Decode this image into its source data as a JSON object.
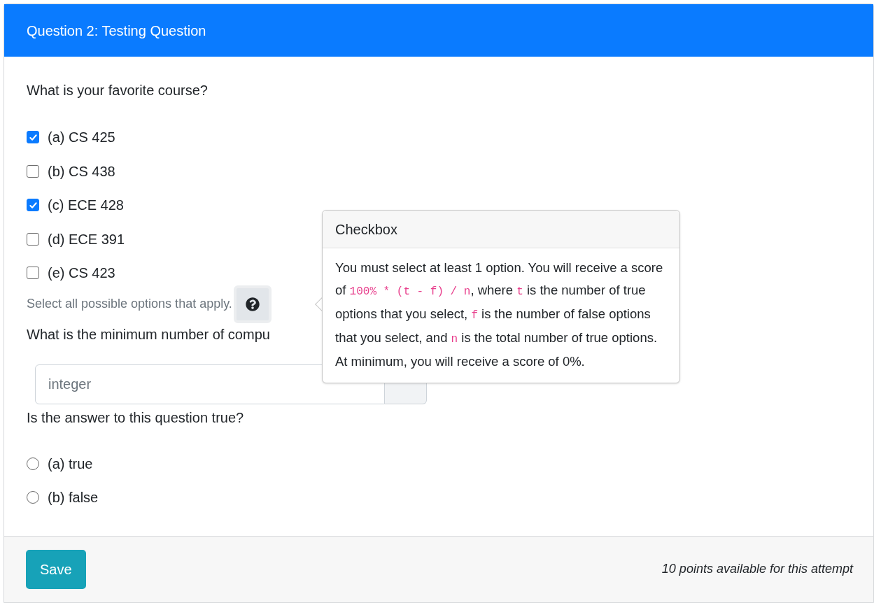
{
  "title": "Question 2: Testing Question",
  "questions": [
    {
      "kind": "checkbox",
      "prompt": "What is your favorite course?",
      "options": [
        {
          "label": "(a) CS 425",
          "checked": true
        },
        {
          "label": "(b) CS 438",
          "checked": false
        },
        {
          "label": "(c) ECE 428",
          "checked": true
        },
        {
          "label": "(d) ECE 391",
          "checked": false
        },
        {
          "label": "(e) CS 423",
          "checked": false
        }
      ],
      "hint": "Select all possible options that apply."
    },
    {
      "kind": "number",
      "prompt": "What is the minimum number of compu",
      "placeholder": "integer"
    },
    {
      "kind": "radio",
      "prompt": "Is the answer to this question true?",
      "options": [
        {
          "label": "(a) true",
          "selected": false
        },
        {
          "label": "(b) false",
          "selected": false
        }
      ]
    }
  ],
  "popover": {
    "title": "Checkbox",
    "body": [
      {
        "kind": "text",
        "text": "You must select at least 1 option. You will receive a score of "
      },
      {
        "kind": "code",
        "text": "100% * (t - f) / n"
      },
      {
        "kind": "text",
        "text": ", where "
      },
      {
        "kind": "code",
        "text": "t"
      },
      {
        "kind": "text",
        "text": " is the number of true options that you select, "
      },
      {
        "kind": "code",
        "text": "f"
      },
      {
        "kind": "text",
        "text": " is the number of false options that you select, and "
      },
      {
        "kind": "code",
        "text": "n"
      },
      {
        "kind": "text",
        "text": " is the total number of true options. At minimum, you will receive a score of 0%."
      }
    ]
  },
  "footer": {
    "button": "Save",
    "note": "10 points available for this attempt"
  }
}
